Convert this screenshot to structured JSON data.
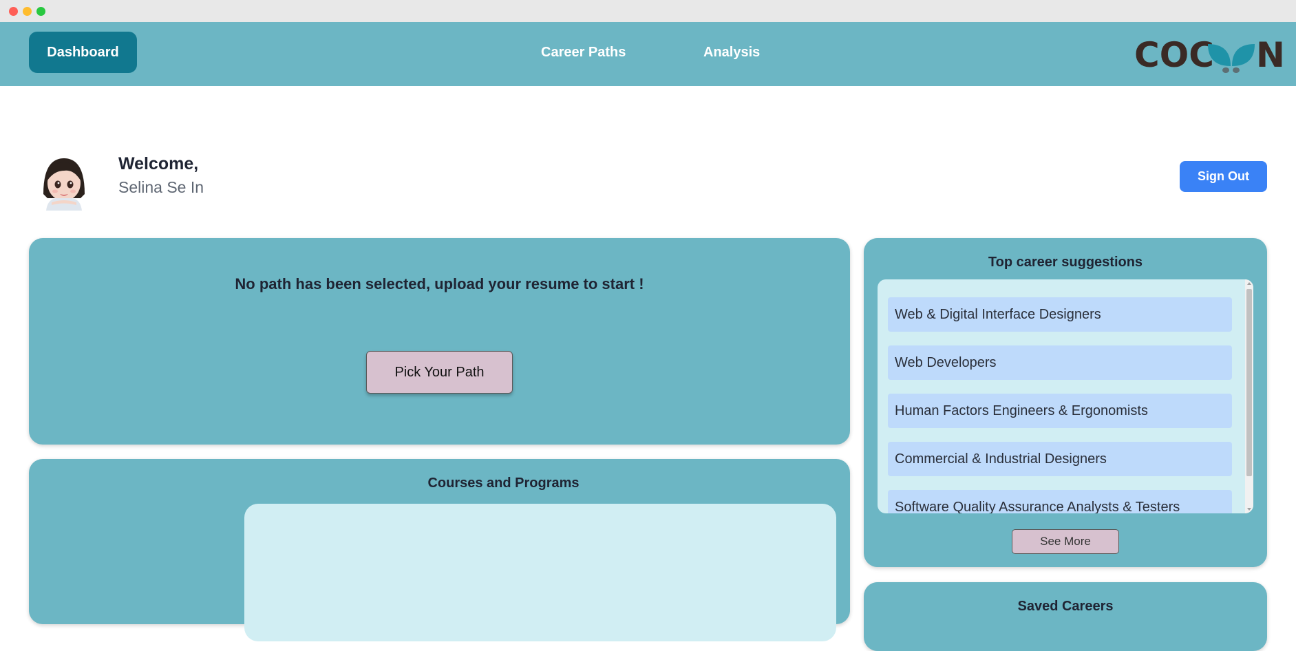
{
  "window": {
    "controls": [
      "close",
      "minimize",
      "maximize"
    ]
  },
  "nav": {
    "dashboard": "Dashboard",
    "career_paths": "Career Paths",
    "analysis": "Analysis",
    "logo_text": "COCOON"
  },
  "user": {
    "welcome": "Welcome,",
    "name": "Selina Se In",
    "sign_out": "Sign Out"
  },
  "path_card": {
    "message": "No path has been selected, upload your resume to start !",
    "button": "Pick Your Path"
  },
  "courses": {
    "title": "Courses and Programs"
  },
  "suggestions": {
    "title": "Top career suggestions",
    "items": [
      "Web & Digital Interface Designers",
      "Web Developers",
      "Human Factors Engineers & Ergonomists",
      "Commercial & Industrial Designers",
      "Software Quality Assurance Analysts & Testers"
    ],
    "see_more": "See More"
  },
  "saved": {
    "title": "Saved Careers"
  },
  "colors": {
    "nav_bg": "#6cb6c4",
    "nav_active": "#11788f",
    "sign_out": "#3a82f6",
    "card_bg": "#6cb6c4",
    "panel_bg": "#d1eef3",
    "item_bg": "#bedafb",
    "button_pink": "#d7c1cf"
  }
}
